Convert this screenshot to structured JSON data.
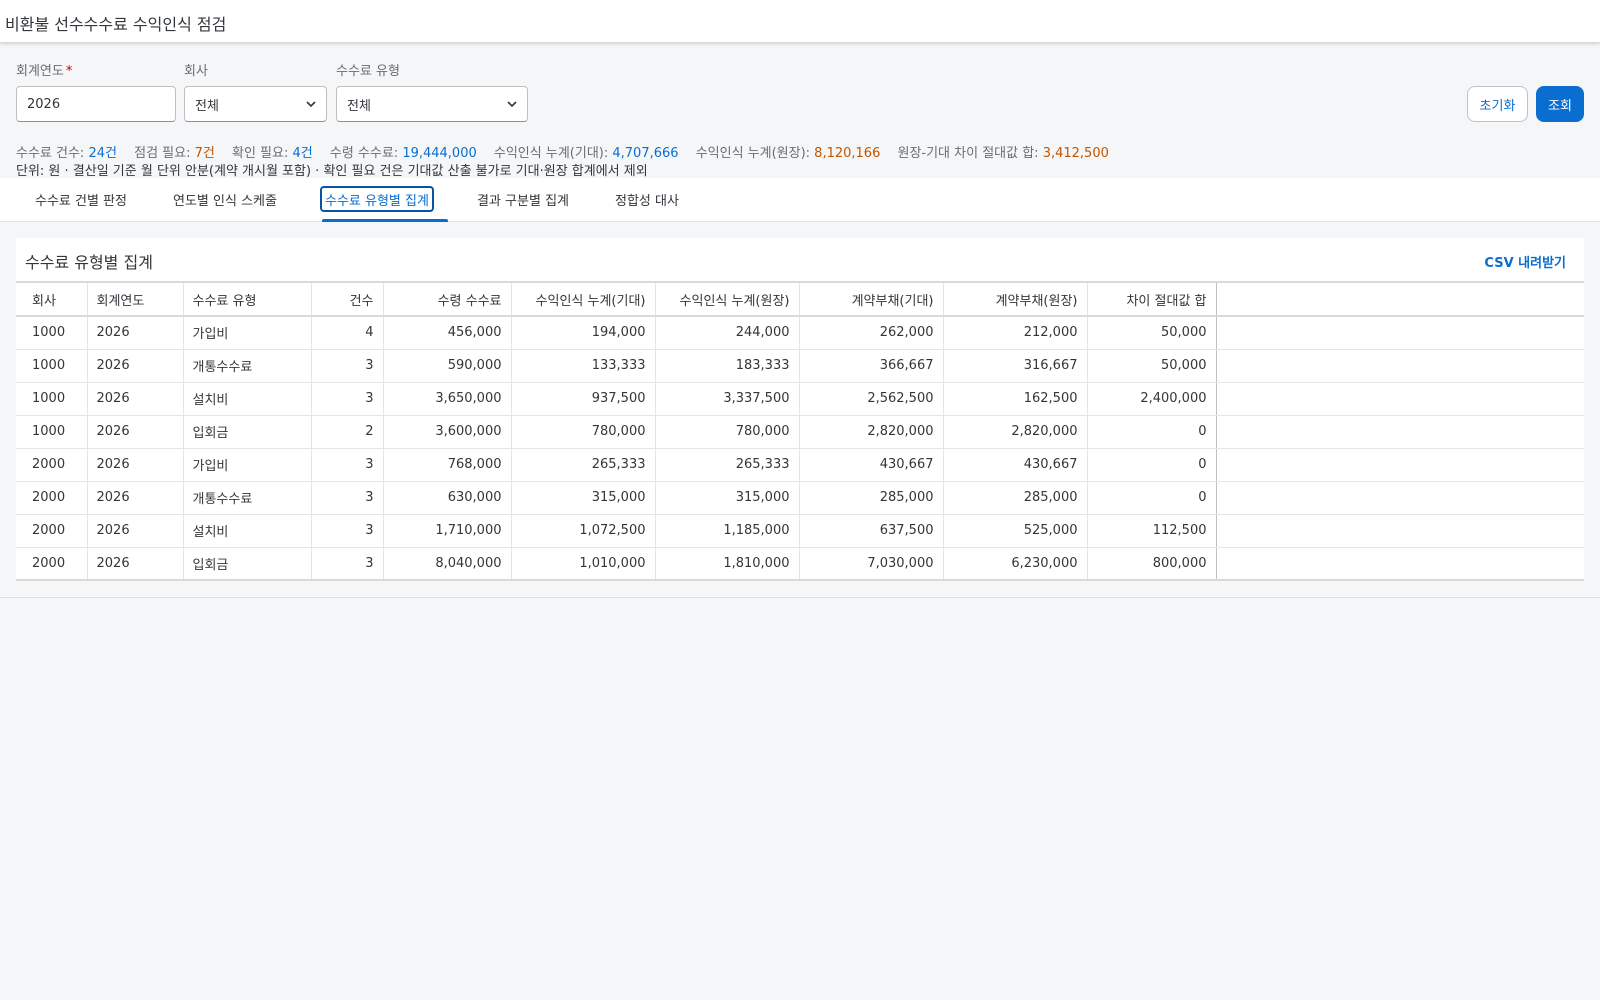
{
  "app": {
    "title": "비환불 선수수수료 수익인식 점검"
  },
  "filters": {
    "fiscal_year": {
      "label": "회계연도",
      "required_mark": "*",
      "value": "2026"
    },
    "company": {
      "label": "회사",
      "value": "전체"
    },
    "fee_type": {
      "label": "수수료 유형",
      "value": "전체"
    }
  },
  "buttons": {
    "reset": "초기화",
    "search": "조회"
  },
  "summary": {
    "fee_count_label": "수수료 건수:",
    "fee_count_value": "24건",
    "check_needed_label": "점검 필요:",
    "check_needed_value": "7건",
    "confirm_needed_label": "확인 필요:",
    "confirm_needed_value": "4건",
    "received_fee_label": "수령 수수료:",
    "received_fee_value": "19,444,000",
    "rev_expected_label": "수익인식 누계(기대):",
    "rev_expected_value": "4,707,666",
    "rev_ledger_label": "수익인식 누계(원장):",
    "rev_ledger_value": "8,120,166",
    "diff_label": "원장-기대 차이 절대값 합:",
    "diff_value": "3,412,500",
    "unit_note": "단위: 원 · 결산일 기준 월 단위 안분(계약 개시월 포함) · 확인 필요 건은 기대값 산출 불가로 기대·원장 합계에서 제외"
  },
  "tabs": [
    {
      "label": "수수료 건별 판정"
    },
    {
      "label": "연도별 인식 스케줄"
    },
    {
      "label": "수수료 유형별 집계"
    },
    {
      "label": "결과 구분별 집계"
    },
    {
      "label": "정합성 대사"
    }
  ],
  "panel": {
    "title": "수수료 유형별 집계",
    "csv_button": "CSV 내려받기"
  },
  "table": {
    "headers": [
      "회사",
      "회계연도",
      "수수료 유형",
      "건수",
      "수령 수수료",
      "수익인식 누계(기대)",
      "수익인식 누계(원장)",
      "계약부채(기대)",
      "계약부채(원장)",
      "차이 절대값 합"
    ],
    "rows": [
      [
        "1000",
        "2026",
        "가입비",
        "4",
        "456,000",
        "194,000",
        "244,000",
        "262,000",
        "212,000",
        "50,000"
      ],
      [
        "1000",
        "2026",
        "개통수수료",
        "3",
        "590,000",
        "133,333",
        "183,333",
        "366,667",
        "316,667",
        "50,000"
      ],
      [
        "1000",
        "2026",
        "설치비",
        "3",
        "3,650,000",
        "937,500",
        "3,337,500",
        "2,562,500",
        "162,500",
        "2,400,000"
      ],
      [
        "1000",
        "2026",
        "입회금",
        "2",
        "3,600,000",
        "780,000",
        "780,000",
        "2,820,000",
        "2,820,000",
        "0"
      ],
      [
        "2000",
        "2026",
        "가입비",
        "3",
        "768,000",
        "265,333",
        "265,333",
        "430,667",
        "430,667",
        "0"
      ],
      [
        "2000",
        "2026",
        "개통수수료",
        "3",
        "630,000",
        "315,000",
        "315,000",
        "285,000",
        "285,000",
        "0"
      ],
      [
        "2000",
        "2026",
        "설치비",
        "3",
        "1,710,000",
        "1,072,500",
        "1,185,000",
        "637,500",
        "525,000",
        "112,500"
      ],
      [
        "2000",
        "2026",
        "입회금",
        "3",
        "8,040,000",
        "1,010,000",
        "1,810,000",
        "7,030,000",
        "6,230,000",
        "800,000"
      ]
    ]
  }
}
